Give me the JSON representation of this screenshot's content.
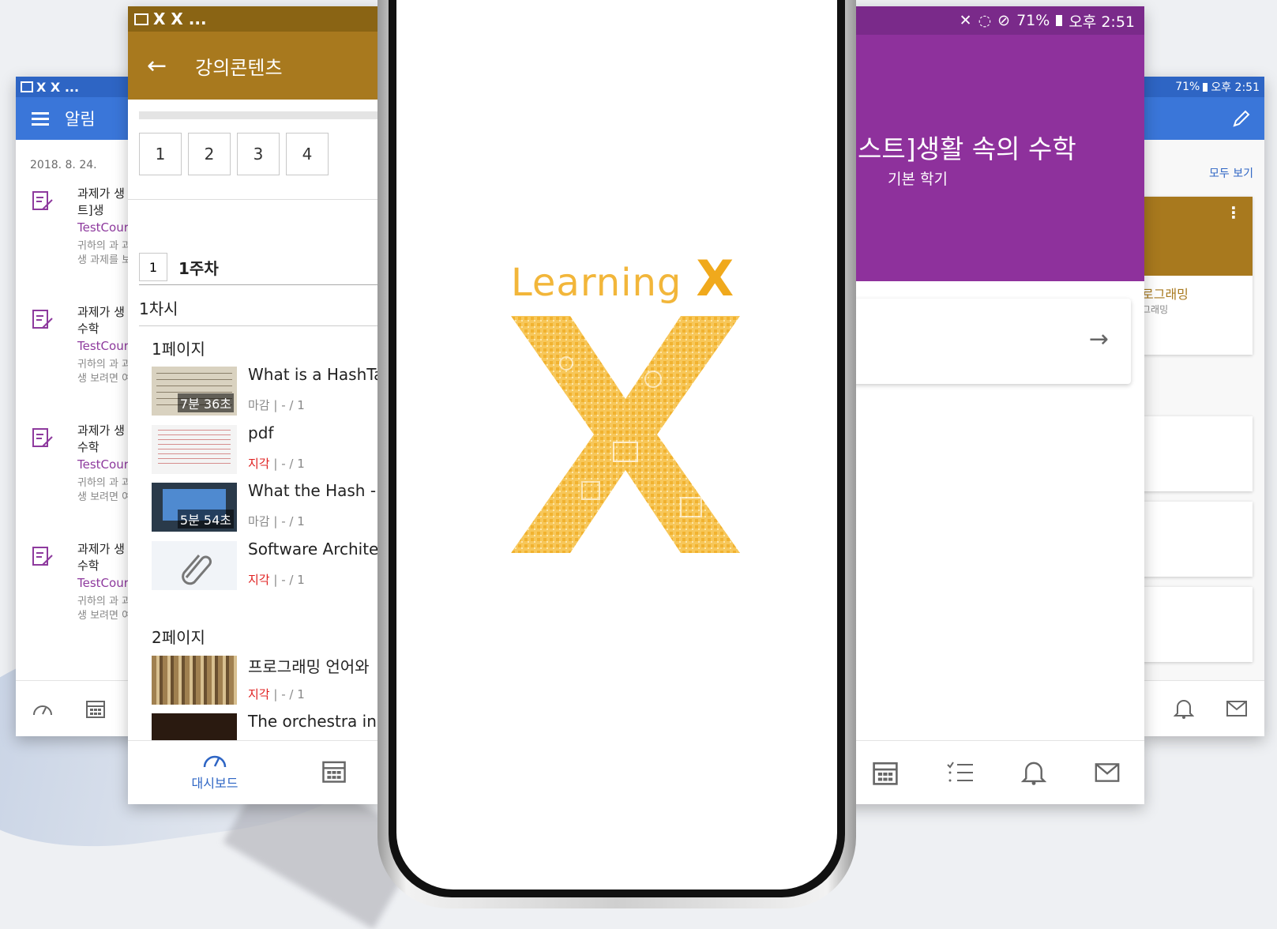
{
  "colors": {
    "notify_blue": "#3a76d9",
    "content_brown": "#a8791e",
    "course_purple": "#8e319c",
    "brand_gold": "#f2b63a",
    "late_red": "#e02020"
  },
  "notify_screen": {
    "status_left": "X X ...",
    "title": "알림",
    "date": "2018. 8. 24.",
    "items": [
      {
        "title": "과제가 생 테스트]생",
        "course": "TestCour",
        "desc": "귀하의 과 과제가 생 과제를 보"
      },
      {
        "title": "과제가 생 속의 수학",
        "course": "TestCour",
        "desc": "귀하의 과 과제가 생 보려면 여"
      },
      {
        "title": "과제가 생 속의 수학",
        "course": "TestCour",
        "desc": "귀하의 과 과제가 생 보려면 여"
      },
      {
        "title": "과제가 생 속의 수학",
        "course": "TestCour",
        "desc": "귀하의 과 과제가 생 보려면 여"
      }
    ]
  },
  "content_screen": {
    "status_left": "X X ...",
    "title": "강의콘텐츠",
    "pages": [
      "1",
      "2",
      "3",
      "4"
    ],
    "week_number": "1",
    "week_label": "1주차",
    "session": "1차시",
    "page1_label": "1페이지",
    "page2_label": "2페이지",
    "items": [
      {
        "name": "What is a HashTa",
        "duration": "7분 36초",
        "status": "마감",
        "meta": " | - / 1"
      },
      {
        "name": "pdf",
        "duration": "",
        "status": "지각",
        "meta": " | - / 1"
      },
      {
        "name": "What the Hash -",
        "duration": "5분 54초",
        "status": "마감",
        "meta": " | - / 1"
      },
      {
        "name": "Software Archite",
        "duration": "",
        "status": "지각",
        "meta": " | - / 1"
      },
      {
        "name": "프로그래밍 언어와",
        "duration": "",
        "status": "지각",
        "meta": " | - / 1"
      },
      {
        "name": "The orchestra in",
        "duration": "",
        "status": "",
        "meta": ""
      }
    ],
    "bottom_tab_label": "대시보드"
  },
  "course_screen": {
    "status_right": "71%",
    "status_time": "오후 2:51",
    "title": "스트]생활 속의 수학",
    "subtitle": "기본 학기"
  },
  "dash_screen": {
    "status_right": "71%",
    "status_time": "오후 2:51",
    "see_all": "모두 보기",
    "card_title": "로그래밍",
    "card_sub": "그래밍"
  },
  "splash": {
    "brand_text": "Learning",
    "brand_x": "X"
  }
}
